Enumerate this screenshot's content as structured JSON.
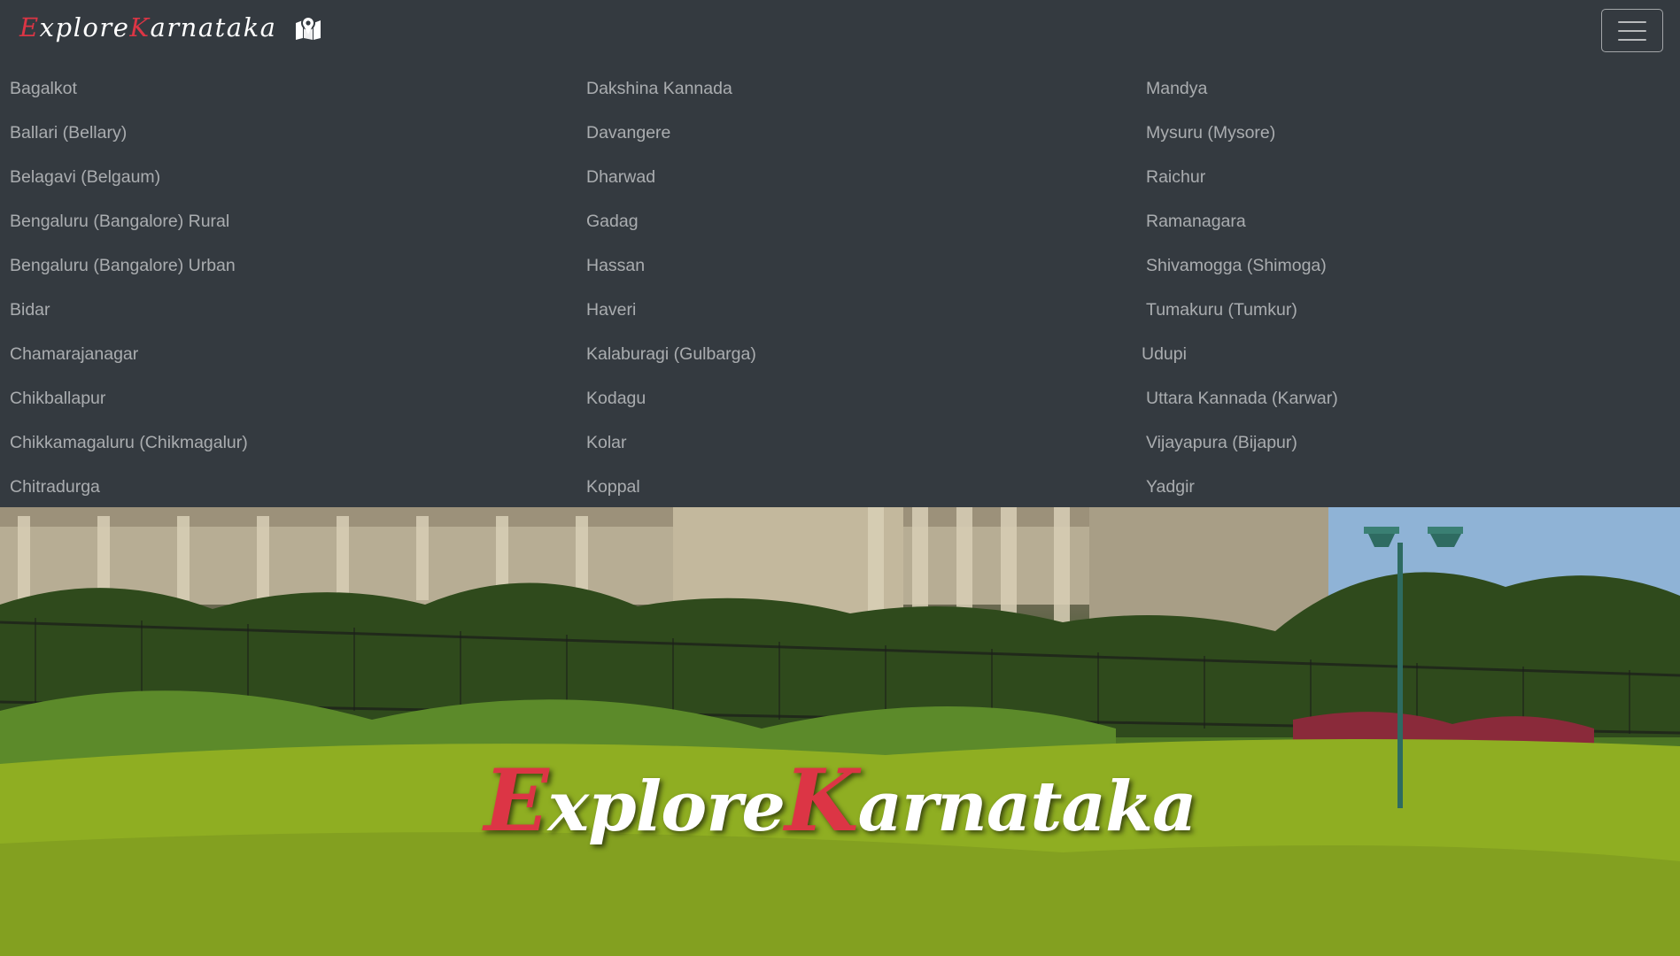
{
  "brand": {
    "e_initial": "E",
    "xplore": "xplore",
    "k_initial": "K",
    "arnataka": "arnataka",
    "icon": "map-marked-icon"
  },
  "navbar": {
    "toggler_icon": "hamburger-menu-icon"
  },
  "districts": {
    "column1": [
      "Bagalkot",
      "Ballari (Bellary)",
      "Belagavi (Belgaum)",
      "Bengaluru (Bangalore) Rural",
      "Bengaluru (Bangalore) Urban",
      "Bidar",
      "Chamarajanagar",
      "Chikballapur",
      "Chikkamagaluru (Chikmagalur)",
      "Chitradurga"
    ],
    "column2": [
      "Dakshina Kannada",
      "Davangere",
      "Dharwad",
      "Gadag",
      "Hassan",
      "Haveri",
      "Kalaburagi (Gulbarga)",
      "Kodagu",
      "Kolar",
      "Koppal"
    ],
    "column3": [
      "Mandya",
      "Mysuru (Mysore)",
      "Raichur",
      "Ramanagara",
      "Shivamogga (Shimoga)",
      "Tumakuru (Tumkur)",
      "Udupi",
      "Uttara Kannada (Karwar)",
      "Vijayapura (Bijapur)",
      "Yadgir"
    ]
  },
  "hero": {
    "e_initial": "E",
    "xplore": "xplore",
    "k_initial": "K",
    "arnataka": "arnataka"
  },
  "colors": {
    "navbar_bg": "#343a40",
    "accent_red": "#dc3545",
    "link_muted": "rgba(255,255,255,0.58)"
  }
}
